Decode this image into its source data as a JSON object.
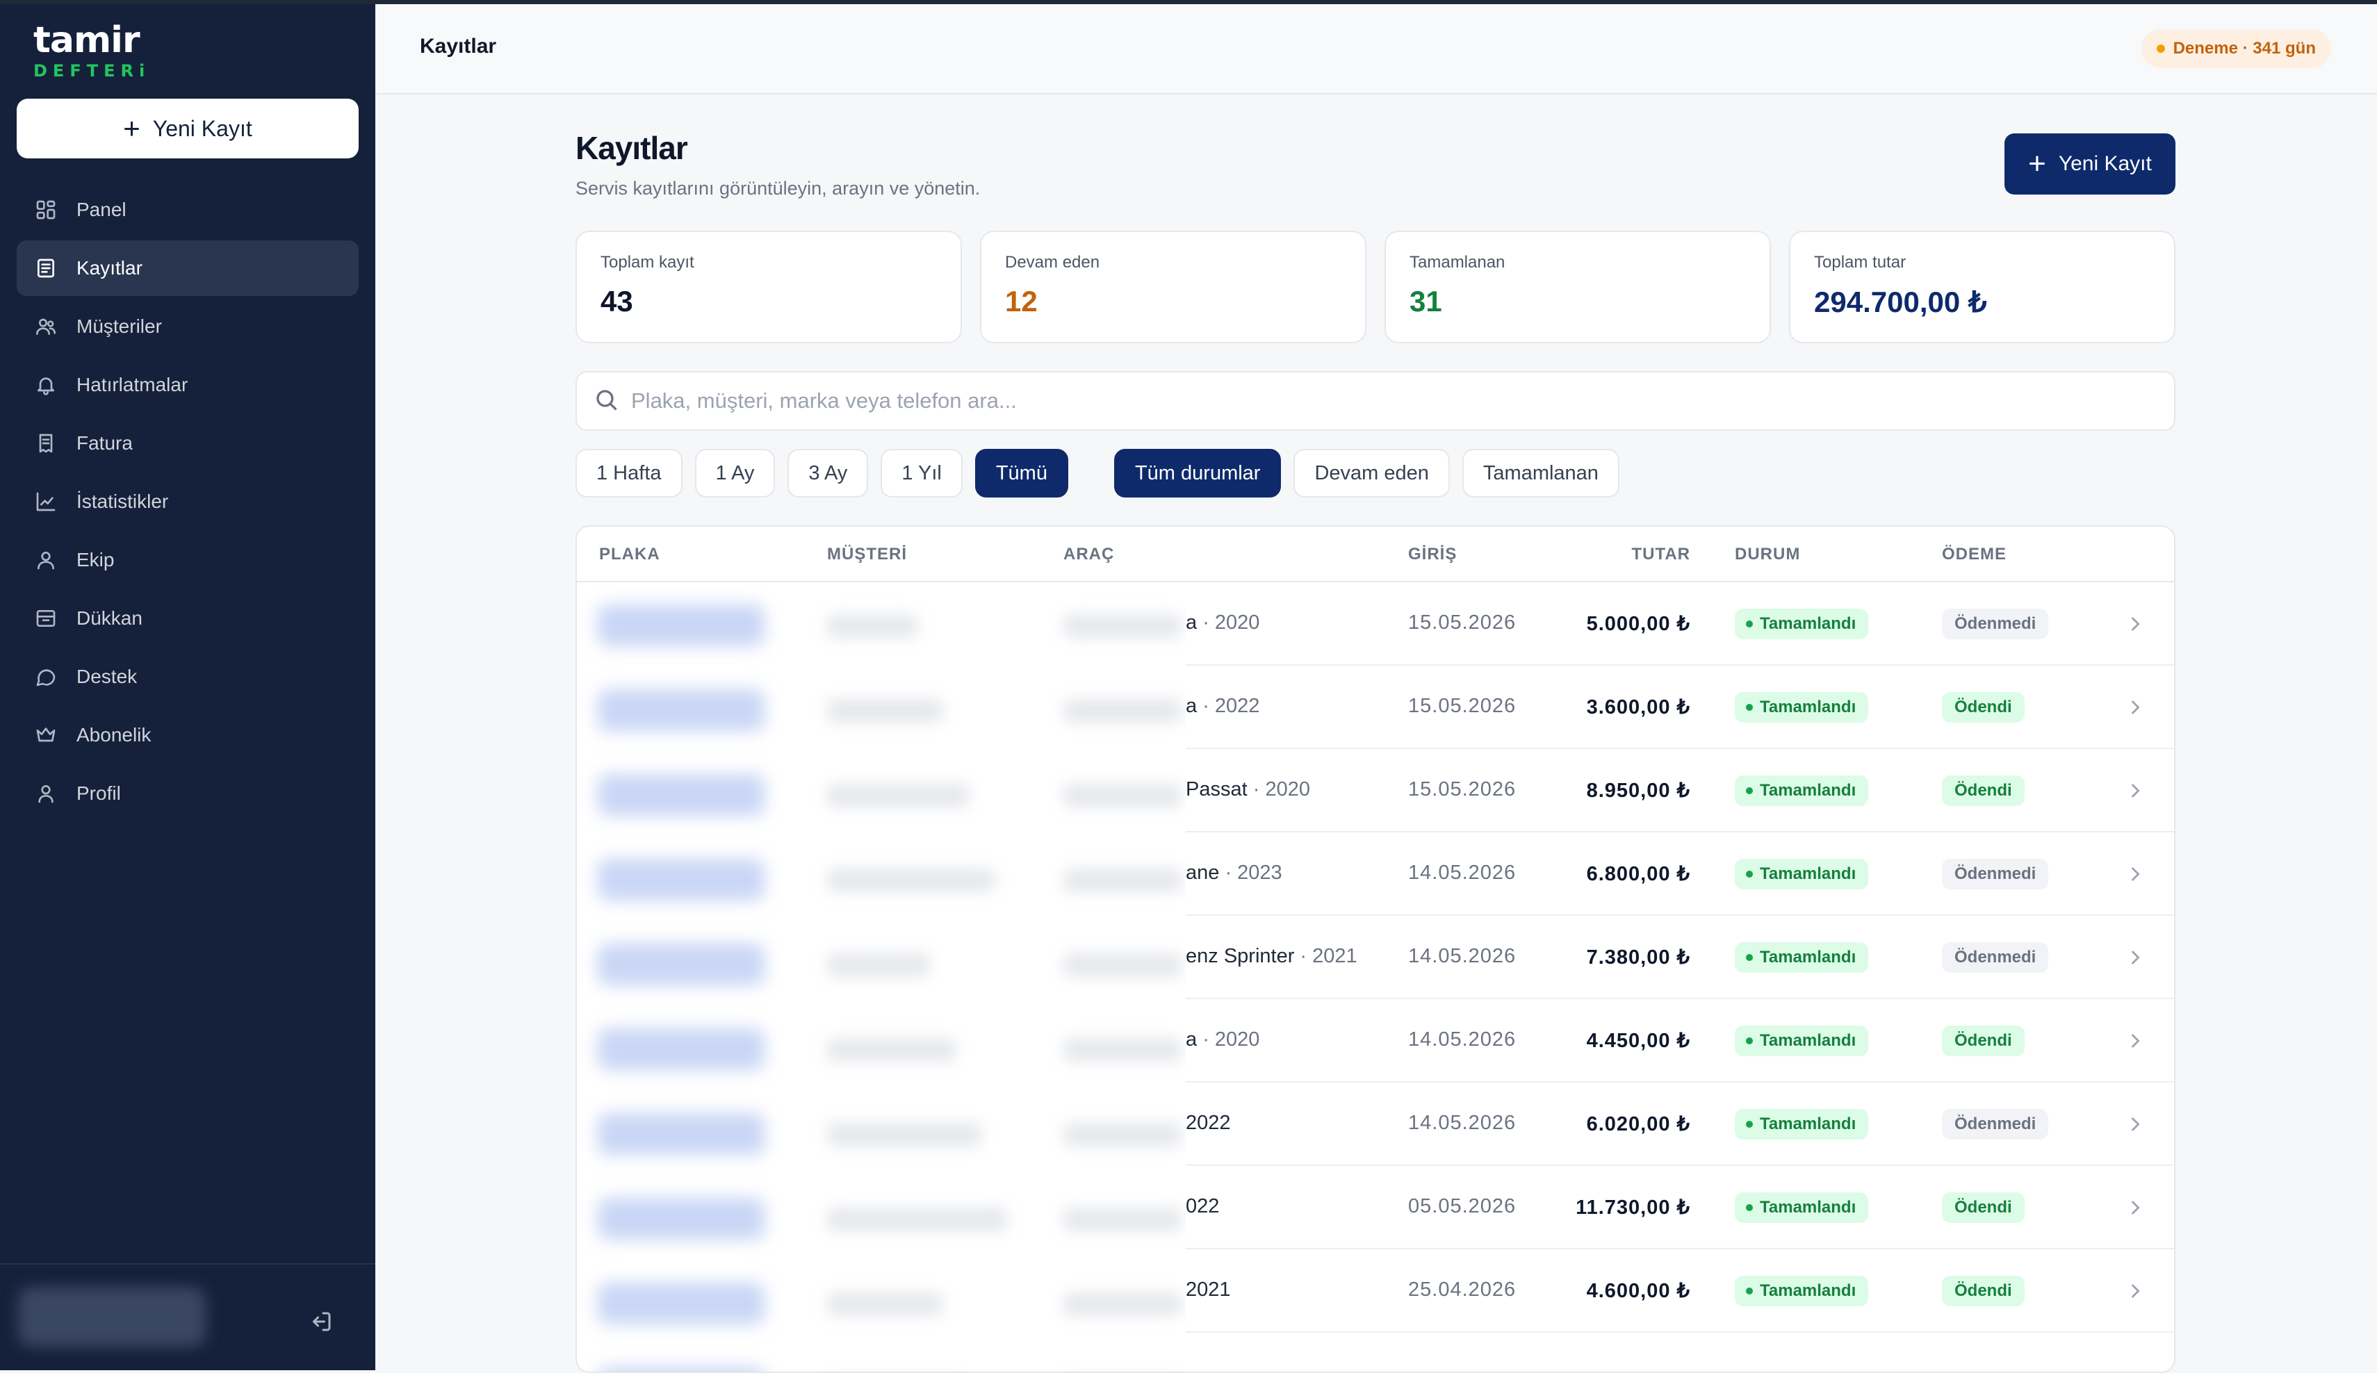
{
  "app": {
    "logo_main": "tamir",
    "logo_sub": "DEFTERi"
  },
  "sidebar": {
    "new_button_label": "Yeni Kayıt",
    "items": [
      {
        "label": "Panel",
        "icon": "grid-icon"
      },
      {
        "label": "Kayıtlar",
        "icon": "document-icon",
        "active": true
      },
      {
        "label": "Müşteriler",
        "icon": "users-icon"
      },
      {
        "label": "Hatırlatmalar",
        "icon": "bell-icon"
      },
      {
        "label": "Fatura",
        "icon": "receipt-icon"
      },
      {
        "label": "İstatistikler",
        "icon": "chart-icon"
      },
      {
        "label": "Ekip",
        "icon": "user-icon"
      },
      {
        "label": "Dükkan",
        "icon": "shop-icon"
      },
      {
        "label": "Destek",
        "icon": "chat-icon"
      },
      {
        "label": "Abonelik",
        "icon": "crown-icon"
      },
      {
        "label": "Profil",
        "icon": "profile-icon"
      }
    ]
  },
  "header": {
    "title": "Kayıtlar",
    "trial_badge": "Deneme · 341 gün"
  },
  "page": {
    "title": "Kayıtlar",
    "subtitle": "Servis kayıtlarını görüntüleyin, arayın ve yönetin.",
    "cta_label": "Yeni Kayıt"
  },
  "stats": [
    {
      "label": "Toplam kayıt",
      "value": "43",
      "color": "#0f172a"
    },
    {
      "label": "Devam eden",
      "value": "12",
      "color": "#c2620d"
    },
    {
      "label": "Tamamlanan",
      "value": "31",
      "color": "#15803d"
    },
    {
      "label": "Toplam tutar",
      "value": "294.700,00 ₺",
      "color": "#0e2a6b"
    }
  ],
  "search": {
    "placeholder": "Plaka, müşteri, marka veya telefon ara..."
  },
  "filters": {
    "period": [
      "1 Hafta",
      "1 Ay",
      "3 Ay",
      "1 Yıl",
      "Tümü"
    ],
    "period_selected": "Tümü",
    "status": [
      "Tüm durumlar",
      "Devam eden",
      "Tamamlanan"
    ],
    "status_selected": "Tüm durumlar"
  },
  "table": {
    "columns": [
      "PLAKA",
      "MÜŞTERİ",
      "ARAÇ",
      "GİRİŞ",
      "TUTAR",
      "DURUM",
      "ÖDEME"
    ],
    "rows": [
      {
        "vehicle": "a",
        "year": "· 2020",
        "date": "15.05.2026",
        "amount": "5.000,00 ₺",
        "status": "Tamamlandı",
        "payment": "Ödenmedi",
        "paid": false
      },
      {
        "vehicle": "a",
        "year": "· 2022",
        "date": "15.05.2026",
        "amount": "3.600,00 ₺",
        "status": "Tamamlandı",
        "payment": "Ödendi",
        "paid": true
      },
      {
        "vehicle": "Passat",
        "year": "· 2020",
        "date": "15.05.2026",
        "amount": "8.950,00 ₺",
        "status": "Tamamlandı",
        "payment": "Ödendi",
        "paid": true
      },
      {
        "vehicle": "ane",
        "year": "· 2023",
        "date": "14.05.2026",
        "amount": "6.800,00 ₺",
        "status": "Tamamlandı",
        "payment": "Ödenmedi",
        "paid": false
      },
      {
        "vehicle": "enz Sprinter",
        "year": "· 2021",
        "date": "14.05.2026",
        "amount": "7.380,00 ₺",
        "status": "Tamamlandı",
        "payment": "Ödenmedi",
        "paid": false
      },
      {
        "vehicle": "a",
        "year": "· 2020",
        "date": "14.05.2026",
        "amount": "4.450,00 ₺",
        "status": "Tamamlandı",
        "payment": "Ödendi",
        "paid": true
      },
      {
        "vehicle": "2022",
        "year": "",
        "date": "14.05.2026",
        "amount": "6.020,00 ₺",
        "status": "Tamamlandı",
        "payment": "Ödenmedi",
        "paid": false
      },
      {
        "vehicle": "022",
        "year": "",
        "date": "05.05.2026",
        "amount": "11.730,00 ₺",
        "status": "Tamamlandı",
        "payment": "Ödendi",
        "paid": true
      },
      {
        "vehicle": "2021",
        "year": "",
        "date": "25.04.2026",
        "amount": "4.600,00 ₺",
        "status": "Tamamlandı",
        "payment": "Ödendi",
        "paid": true
      }
    ]
  },
  "colors": {
    "sidebar_bg": "#15213b",
    "primary": "#0e2a6b",
    "success": "#15803d",
    "warning": "#c2620d",
    "logo_accent": "#22c55e"
  }
}
